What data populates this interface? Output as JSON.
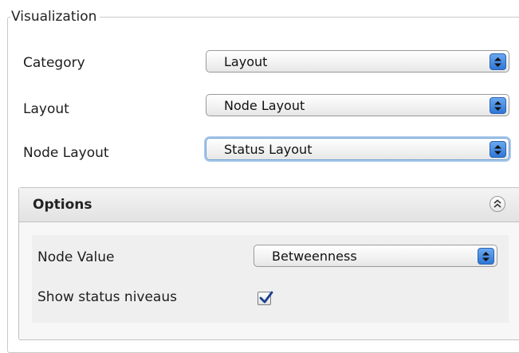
{
  "visualization": {
    "title": "Visualization",
    "rows": [
      {
        "label": "Category",
        "value": "Layout"
      },
      {
        "label": "Layout",
        "value": "Node Layout"
      },
      {
        "label": "Node Layout",
        "value": "Status Layout"
      }
    ]
  },
  "options": {
    "title": "Options",
    "node_value_label": "Node Value",
    "node_value": "Betweenness",
    "show_status_label": "Show status niveaus",
    "show_status_checked": true
  },
  "colors": {
    "accent": "#2f76d6",
    "focus_ring": "#a9c8ec",
    "checkmark": "#1b3f8f"
  },
  "icons": {
    "select_arrows": "up-down-arrows-icon",
    "collapse": "double-chevron-up-icon",
    "checkmark": "checkmark-icon"
  }
}
